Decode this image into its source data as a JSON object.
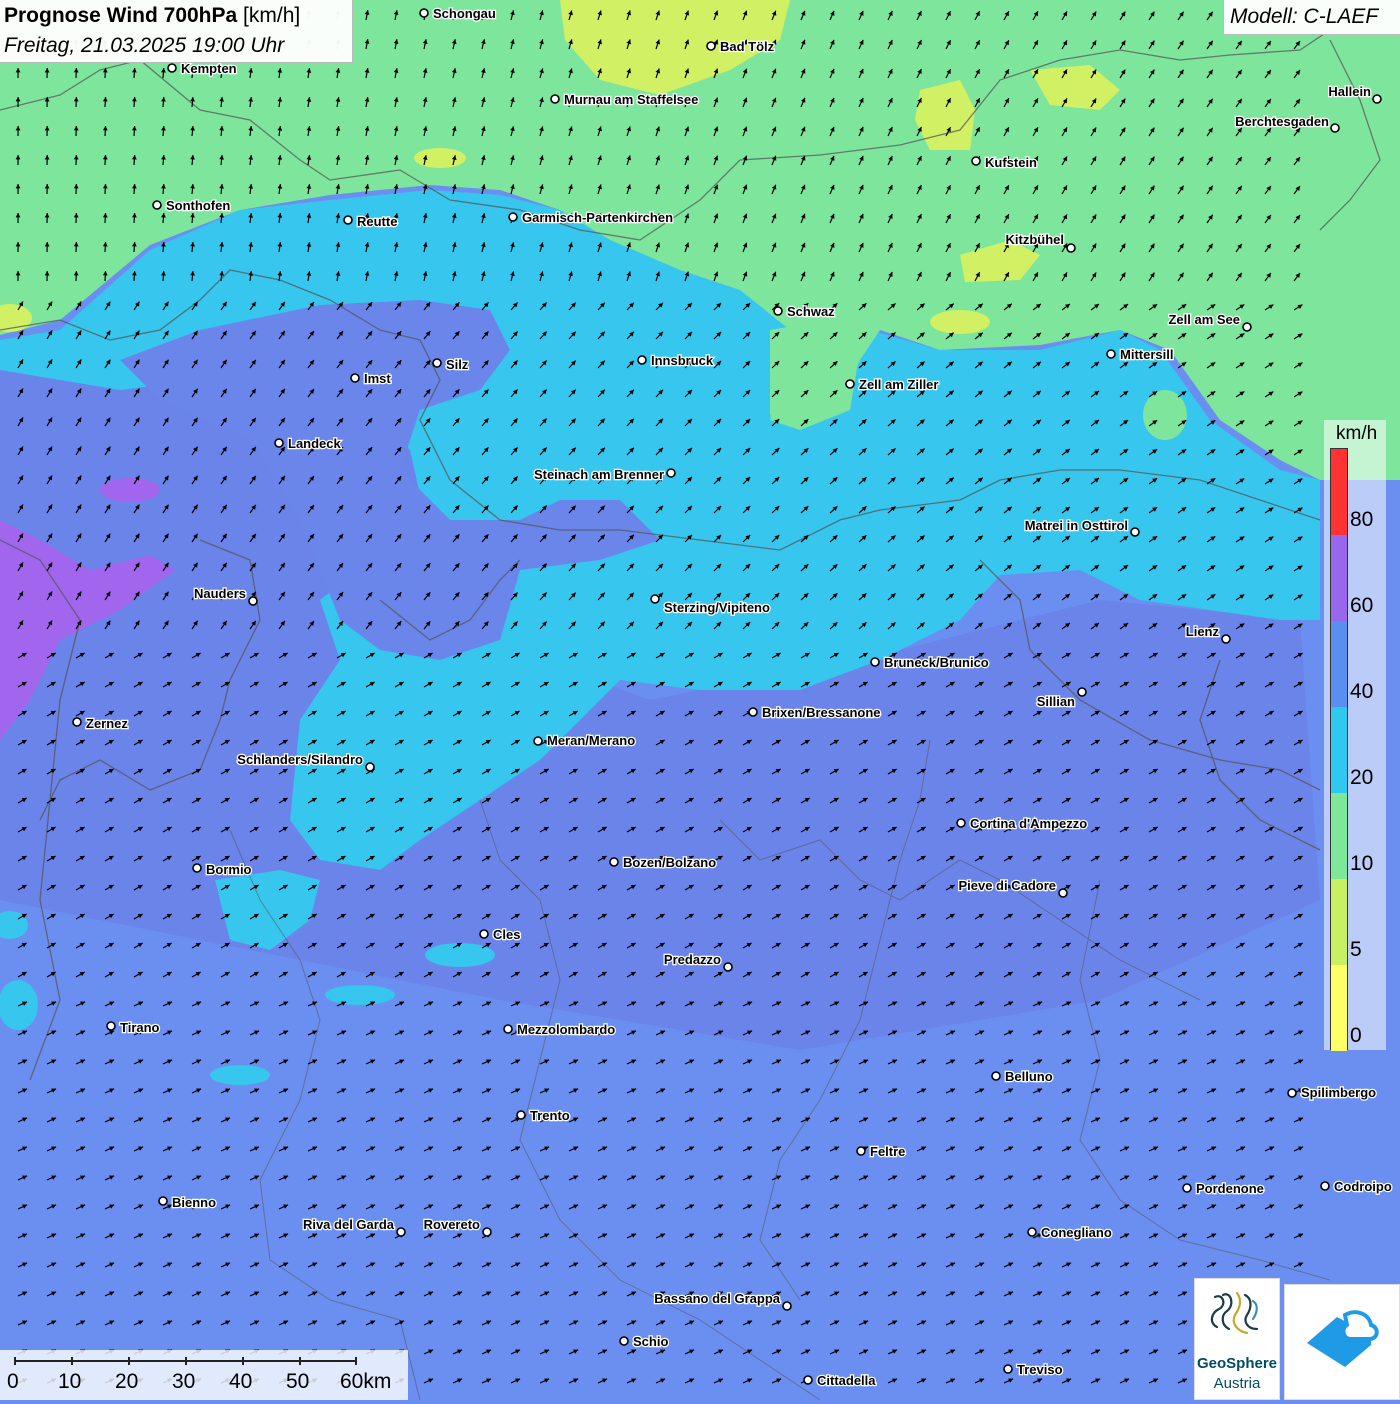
{
  "title": {
    "main": "Prognose Wind 700hPa",
    "unit": "[km/h]",
    "datetime": "Freitag, 21.03.2025 19:00 Uhr"
  },
  "model_label": "Modell: C-LAEF",
  "legend": {
    "unit": "km/h",
    "ticks": [
      "80",
      "60",
      "40",
      "20",
      "10",
      "5",
      "0"
    ],
    "colors": [
      "#ff3333",
      "#9966ee",
      "#5a8ef0",
      "#2ec8f0",
      "#7de89a",
      "#c9f060",
      "#ffff66"
    ]
  },
  "scale_bar": {
    "labels": [
      "0",
      "10",
      "20",
      "30",
      "40",
      "50",
      "60km"
    ]
  },
  "cities": [
    {
      "name": "Schongau"
    },
    {
      "name": "Bad Tölz"
    },
    {
      "name": "Kempten"
    },
    {
      "name": "Murnau am Staffelsee"
    },
    {
      "name": "Hallein"
    },
    {
      "name": "Berchtesgaden"
    },
    {
      "name": "Kufstein"
    },
    {
      "name": "Sonthofen"
    },
    {
      "name": "Reutte"
    },
    {
      "name": "Garmisch-Partenkirchen"
    },
    {
      "name": "Kitzbühel"
    },
    {
      "name": "Schwaz"
    },
    {
      "name": "Zell am See"
    },
    {
      "name": "Mittersill"
    },
    {
      "name": "Imst"
    },
    {
      "name": "Silz"
    },
    {
      "name": "Innsbruck"
    },
    {
      "name": "Zell am Ziller"
    },
    {
      "name": "Landeck"
    },
    {
      "name": "Steinach am Brenner"
    },
    {
      "name": "Matrei in Osttirol"
    },
    {
      "name": "Nauders"
    },
    {
      "name": "Sterzing/Vipiteno"
    },
    {
      "name": "Lienz"
    },
    {
      "name": "Bruneck/Brunico"
    },
    {
      "name": "Sillian"
    },
    {
      "name": "Zernez"
    },
    {
      "name": "Brixen/Bressanone"
    },
    {
      "name": "Meran/Merano"
    },
    {
      "name": "Schlanders/Silandro"
    },
    {
      "name": "Cortina d'Ampezzo"
    },
    {
      "name": "Bozen/Bolzano"
    },
    {
      "name": "Bormio"
    },
    {
      "name": "Pieve di Cadore"
    },
    {
      "name": "Cles"
    },
    {
      "name": "Predazzo"
    },
    {
      "name": "Tirano"
    },
    {
      "name": "Mezzolombardo"
    },
    {
      "name": "Belluno"
    },
    {
      "name": "Spilimbergo"
    },
    {
      "name": "Trento"
    },
    {
      "name": "Feltre"
    },
    {
      "name": "Pordenone"
    },
    {
      "name": "Codroipo"
    },
    {
      "name": "Bienno"
    },
    {
      "name": "Riva del Garda"
    },
    {
      "name": "Rovereto"
    },
    {
      "name": "Conegliano"
    },
    {
      "name": "Bassano del Grappa"
    },
    {
      "name": "Schio"
    },
    {
      "name": "Treviso"
    },
    {
      "name": "Cittadella"
    }
  ],
  "wind_field": {
    "dominant_direction": "north-northeast",
    "arrow_color": "#000000"
  },
  "logos": {
    "geosphere_name": "GeoSphere",
    "geosphere_sub": "Austria"
  }
}
